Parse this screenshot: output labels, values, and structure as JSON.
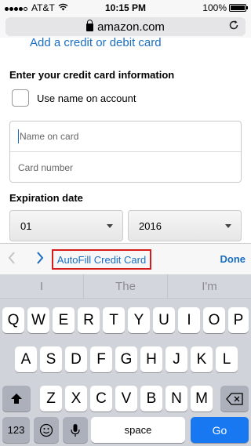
{
  "status_bar": {
    "carrier": "AT&T",
    "time": "10:15 PM",
    "battery": "100%"
  },
  "browser": {
    "domain": "amazon.com",
    "reload_icon": "reload-icon"
  },
  "form": {
    "add_card_link": "Add a credit or debit card",
    "section_title": "Enter your credit card information",
    "checkbox_label": "Use name on account",
    "name_placeholder": "Name on card",
    "number_placeholder": "Card number",
    "expiration_label": "Expiration date",
    "month_value": "01",
    "year_value": "2016"
  },
  "accessory": {
    "autofill_label": "AutoFill Credit Card",
    "done_label": "Done"
  },
  "keyboard": {
    "suggestions": [
      "I",
      "The",
      "I'm"
    ],
    "row1": [
      "Q",
      "W",
      "E",
      "R",
      "T",
      "Y",
      "U",
      "I",
      "O",
      "P"
    ],
    "row2": [
      "A",
      "S",
      "D",
      "F",
      "G",
      "H",
      "J",
      "K",
      "L"
    ],
    "row3": [
      "Z",
      "X",
      "C",
      "V",
      "B",
      "N",
      "M"
    ],
    "num_label": "123",
    "space_label": "space",
    "go_label": "Go"
  },
  "colors": {
    "link_blue": "#1a6ec1",
    "highlight_red": "#d81b1b",
    "go_blue": "#1878f2"
  }
}
